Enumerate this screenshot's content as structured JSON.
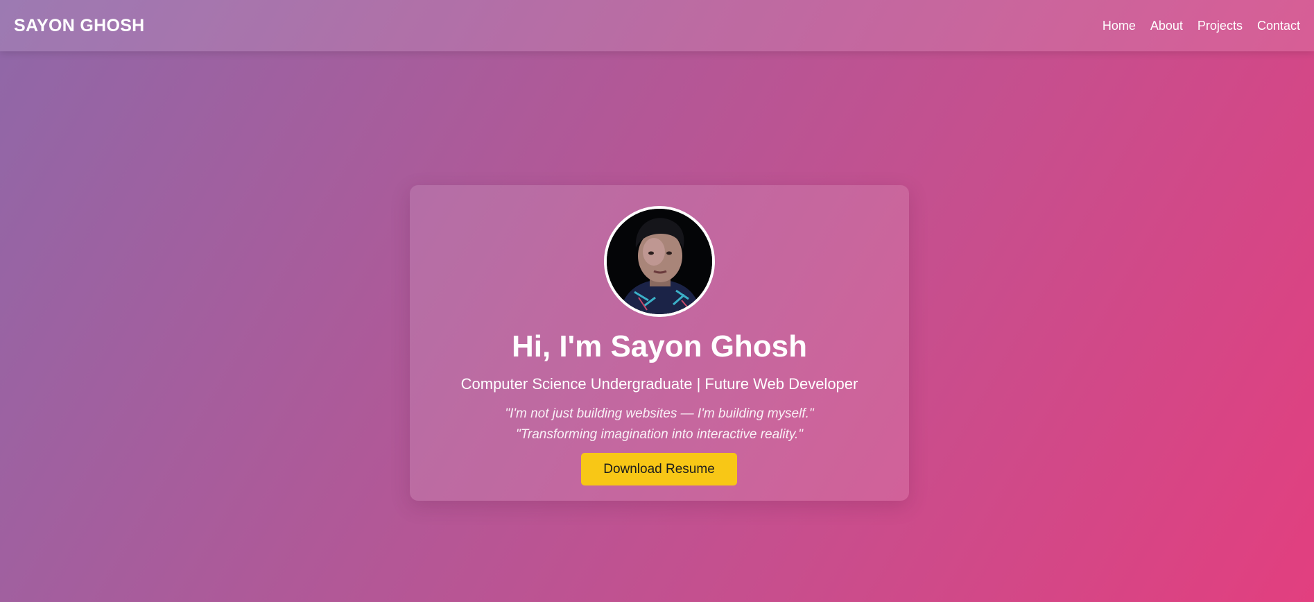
{
  "nav": {
    "brand": "SAYON GHOSH",
    "links": [
      "Home",
      "About",
      "Projects",
      "Contact"
    ]
  },
  "hero": {
    "title": "Hi, I'm Sayon Ghosh",
    "subtitle": "Computer Science Undergraduate | Future Web Developer",
    "quote_1": "\"I'm not just building websites — I'm building myself.\"",
    "quote_2": "\"Transforming imagination into interactive reality.\"",
    "button_label": "Download Resume"
  },
  "colors": {
    "button": "#f8c716",
    "gradient_start": "#8f68a8",
    "gradient_end": "#e23f7f"
  }
}
